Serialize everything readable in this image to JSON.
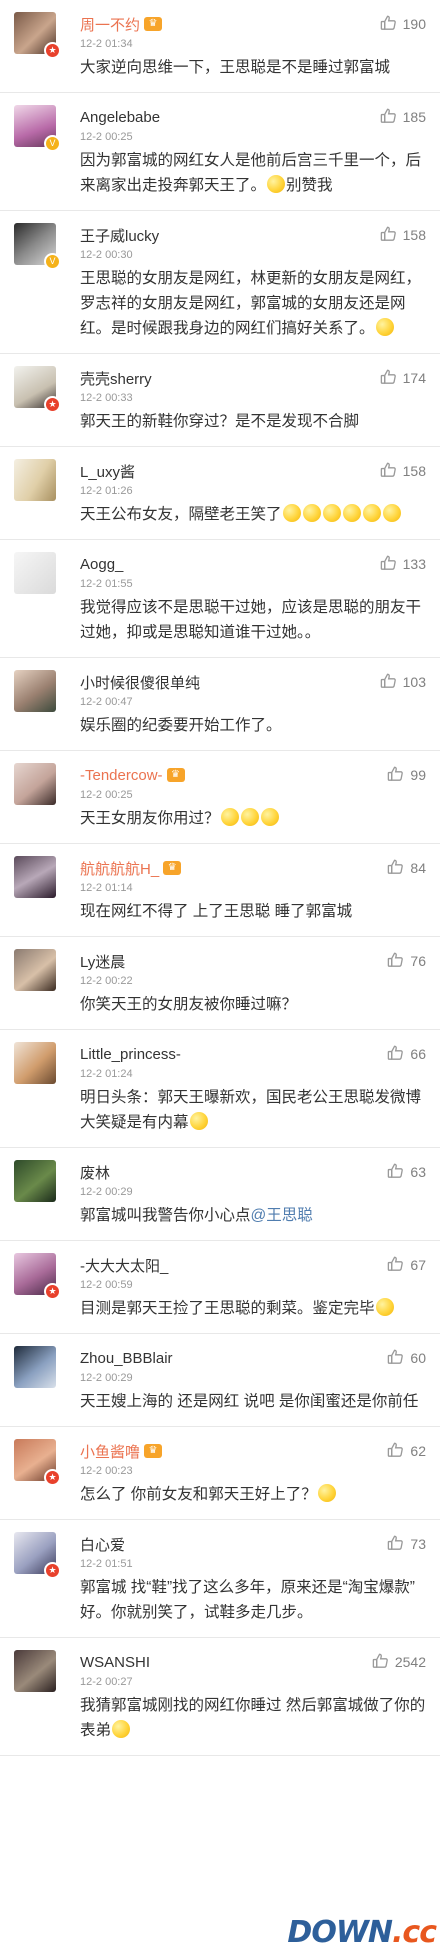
{
  "comments": [
    {
      "name": "周一不约",
      "name_color": "orange",
      "vip": true,
      "badge": "red",
      "time": "12-2 01:34",
      "likes": "190",
      "segments": [
        {
          "t": "大家逆向思维一下，王思聪是不是睡过郭富城"
        }
      ]
    },
    {
      "name": "Angelebabe",
      "name_color": "normal",
      "vip": false,
      "badge": "gold",
      "time": "12-2 00:25",
      "likes": "185",
      "segments": [
        {
          "t": "因为郭富城的网红女人是他前后宫三千里一个，后来离家出走投奔郭天王了。"
        },
        {
          "e": 1
        },
        {
          "t": "别赞我"
        }
      ]
    },
    {
      "name": "王子威lucky",
      "name_color": "normal",
      "vip": false,
      "badge": "gold",
      "time": "12-2 00:30",
      "likes": "158",
      "segments": [
        {
          "t": "王思聪的女朋友是网红，林更新的女朋友是网红，罗志祥的女朋友是网红，郭富城的女朋友还是网红。是时候跟我身边的网红们搞好关系了。"
        },
        {
          "e": 1
        }
      ]
    },
    {
      "name": "壳壳sherry",
      "name_color": "normal",
      "vip": false,
      "badge": "red",
      "time": "12-2 00:33",
      "likes": "174",
      "segments": [
        {
          "t": "郭天王的新鞋你穿过？是不是发现不合脚"
        }
      ]
    },
    {
      "name": "L_uxy酱",
      "name_color": "normal",
      "vip": false,
      "badge": "",
      "time": "12-2 01:26",
      "likes": "158",
      "segments": [
        {
          "t": "天王公布女友，隔壁老王笑了"
        },
        {
          "e": 6
        }
      ]
    },
    {
      "name": "Aogg_",
      "name_color": "normal",
      "vip": false,
      "badge": "",
      "time": "12-2 01:55",
      "likes": "133",
      "segments": [
        {
          "t": "我觉得应该不是思聪干过她，应该是思聪的朋友干过她，抑或是思聪知道谁干过她。。"
        }
      ]
    },
    {
      "name": "小时候很傻很单纯",
      "name_color": "normal",
      "vip": false,
      "badge": "",
      "time": "12-2 00:47",
      "likes": "103",
      "segments": [
        {
          "t": "娱乐圈的纪委要开始工作了。"
        }
      ]
    },
    {
      "name": "-Tendercow-",
      "name_color": "orange",
      "vip": true,
      "badge": "",
      "time": "12-2 00:25",
      "likes": "99",
      "segments": [
        {
          "t": "天王女朋友你用过？"
        },
        {
          "e": 3
        }
      ]
    },
    {
      "name": "航航航航H_",
      "name_color": "orange",
      "vip": true,
      "badge": "",
      "time": "12-2 01:14",
      "likes": "84",
      "segments": [
        {
          "t": "现在网红不得了 上了王思聪 睡了郭富城"
        }
      ]
    },
    {
      "name": "Ly迷晨",
      "name_color": "normal",
      "vip": false,
      "badge": "",
      "time": "12-2 00:22",
      "likes": "76",
      "segments": [
        {
          "t": "你笑天王的女朋友被你睡过嘛？"
        }
      ]
    },
    {
      "name": "Little_princess-",
      "name_color": "normal",
      "vip": false,
      "badge": "",
      "time": "12-2 01:24",
      "likes": "66",
      "segments": [
        {
          "t": "明日头条：郭天王曝新欢，国民老公王思聪发微博大笑疑是有内幕"
        },
        {
          "e": 1
        }
      ]
    },
    {
      "name": "废林",
      "name_color": "normal",
      "vip": false,
      "badge": "",
      "time": "12-2 00:29",
      "likes": "63",
      "segments": [
        {
          "t": "郭富城叫我警告你小心点"
        },
        {
          "m": "@王思聪"
        }
      ]
    },
    {
      "name": "-大大大太阳_",
      "name_color": "normal",
      "vip": false,
      "badge": "red",
      "time": "12-2 00:59",
      "likes": "67",
      "segments": [
        {
          "t": "目测是郭天王捡了王思聪的剩菜。鉴定完毕"
        },
        {
          "e": 1
        }
      ]
    },
    {
      "name": "Zhou_BBBlair",
      "name_color": "normal",
      "vip": false,
      "badge": "",
      "time": "12-2 00:29",
      "likes": "60",
      "segments": [
        {
          "t": "天王嫂上海的 还是网红 说吧 是你闺蜜还是你前任"
        }
      ]
    },
    {
      "name": "小鱼酱噜",
      "name_color": "orange",
      "vip": true,
      "badge": "red",
      "time": "12-2 00:23",
      "likes": "62",
      "segments": [
        {
          "t": "怎么了 你前女友和郭天王好上了？"
        },
        {
          "e": 1
        }
      ]
    },
    {
      "name": "白心爱",
      "name_color": "normal",
      "vip": false,
      "badge": "red",
      "time": "12-2 01:51",
      "likes": "73",
      "segments": [
        {
          "t": "郭富城 找“鞋”找了这么多年，原来还是“淘宝爆款” 好。你就别笑了，试鞋多走几步。"
        }
      ]
    },
    {
      "name": "WSANSHI",
      "name_color": "normal",
      "vip": false,
      "badge": "",
      "time": "12-2 00:27",
      "likes": "2542",
      "segments": [
        {
          "t": "我猜郭富城刚找的网红你睡过 然后郭富城做了你的表弟"
        },
        {
          "e": 1
        }
      ]
    }
  ],
  "watermark": {
    "main": "DOWN",
    "suffix": ".cc"
  },
  "icons": {
    "like": "thumbs-up-icon",
    "vip": "crown-icon",
    "emoji": "smiley-emoji-icon"
  },
  "colors": {
    "orange_name": "#eb7350",
    "mention": "#507daf",
    "badge_red": "#e8412c",
    "badge_gold": "#f5b21a"
  }
}
